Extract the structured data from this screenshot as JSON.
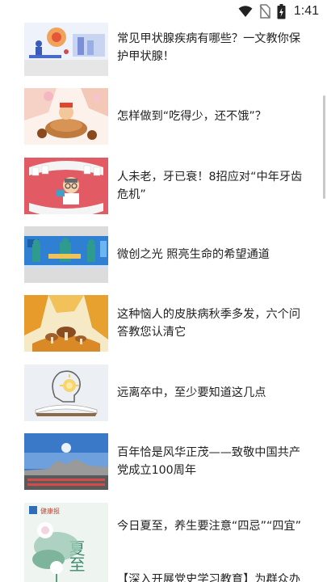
{
  "status_bar": {
    "time": "1:41",
    "icons": [
      "wifi-icon",
      "no-sim-icon",
      "battery-icon"
    ]
  },
  "articles": [
    {
      "title": "常见甲状腺疾病有哪些？一文教你保护甲状腺！",
      "thumbnail": "thyroid-illustration"
    },
    {
      "title": "怎样做到“吃得少，还不饿”？",
      "thumbnail": "food-illustration"
    },
    {
      "title": "人未老，牙已衰！8招应对“中年牙齿危机”",
      "thumbnail": "teeth-illustration"
    },
    {
      "title": "微创之光 照亮生命的希望通道",
      "thumbnail": "surgery-illustration"
    },
    {
      "title": "这种恼人的皮肤病秋季多发，六个问答教您认清它",
      "thumbnail": "autumn-illustration"
    },
    {
      "title": "远离卒中，至少要知道这几点",
      "thumbnail": "brain-bulb-illustration"
    },
    {
      "title": "百年恰是风华正茂——致敬中国共产党成立100周年",
      "thumbnail": "city-photo"
    },
    {
      "title": "今日夏至，养生要注意“四忌”“四宜”",
      "thumbnail": "summer-solstice-poster",
      "poster_text": "夏至",
      "poster_brand": "健康报"
    },
    {
      "title": "【深入开展党史学习教育】为群众办"
    }
  ]
}
